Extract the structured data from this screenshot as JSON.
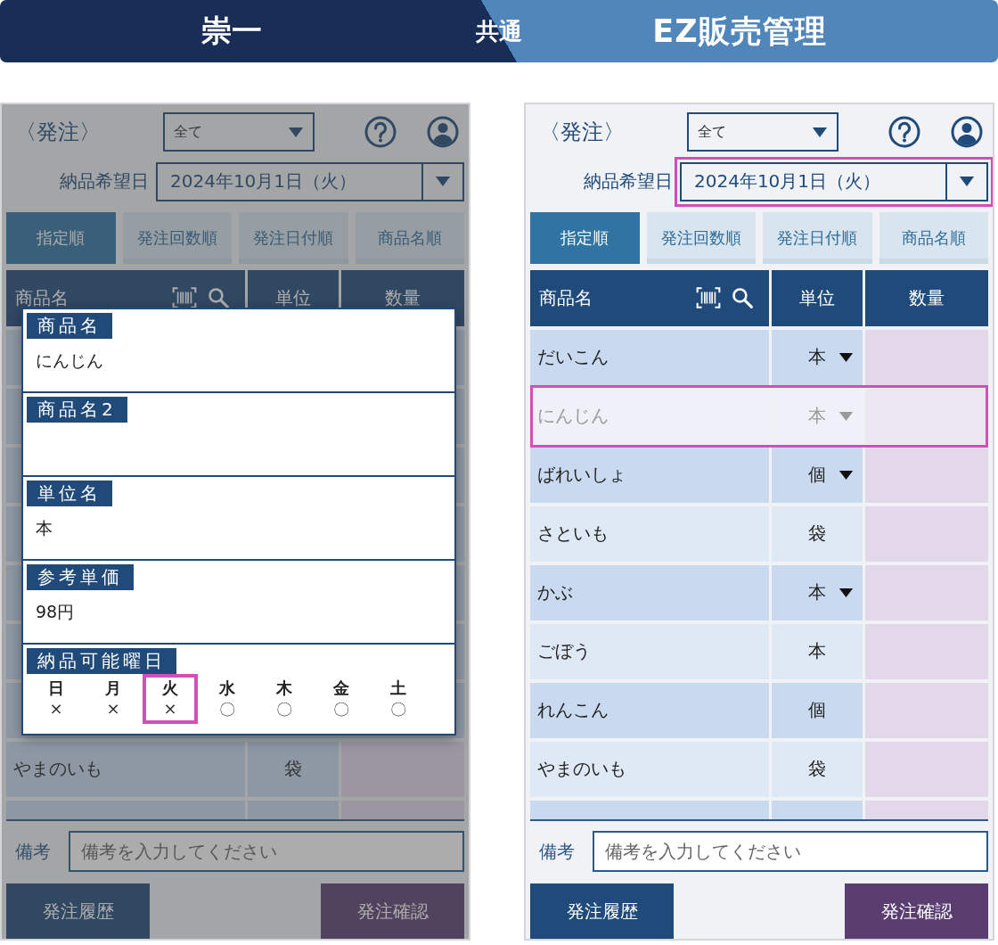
{
  "banner": {
    "left": "崇一",
    "center": "共通",
    "right": "EZ販売管理"
  },
  "screens": [
    {
      "title": "〈発注〉",
      "filter": "全て",
      "date_label": "納品希望日",
      "date": "2024年10月1日（火）",
      "date_highlighted": false,
      "dimmed": true,
      "sort_tabs": [
        {
          "label": "指定順",
          "selected": true
        },
        {
          "label": "発注回数順",
          "selected": false
        },
        {
          "label": "発注日付順",
          "selected": false
        },
        {
          "label": "商品名順",
          "selected": false
        }
      ],
      "columns": [
        "商品名",
        "単位",
        "数量"
      ],
      "rows": [
        {
          "name": "やまのいも",
          "unit": "袋",
          "kind": "fixed",
          "disabled": false,
          "highlighted": false
        }
      ],
      "note_label": "備考",
      "note_placeholder": "備考を入力してください",
      "buttons": [
        "発注履歴",
        "発注確認"
      ],
      "detail_popup": {
        "fields": [
          {
            "label": "商品名",
            "value": "にんじん"
          },
          {
            "label": "商品名2"
          },
          {
            "label": "単位名",
            "value": "本"
          },
          {
            "label": "参考単価",
            "value": "98円"
          }
        ],
        "weekday_label": "納品可能曜日",
        "weekdays": [
          {
            "day": "日",
            "mark": "×",
            "highlighted": false
          },
          {
            "day": "月",
            "mark": "×",
            "highlighted": false
          },
          {
            "day": "火",
            "mark": "×",
            "highlighted": true
          },
          {
            "day": "水",
            "mark": "〇",
            "highlighted": false
          },
          {
            "day": "木",
            "mark": "〇",
            "highlighted": false
          },
          {
            "day": "金",
            "mark": "〇",
            "highlighted": false
          },
          {
            "day": "土",
            "mark": "〇",
            "highlighted": false
          }
        ]
      }
    },
    {
      "title": "〈発注〉",
      "filter": "全て",
      "date_label": "納品希望日",
      "date": "2024年10月1日（火）",
      "date_highlighted": true,
      "dimmed": false,
      "sort_tabs": [
        {
          "label": "指定順",
          "selected": true
        },
        {
          "label": "発注回数順",
          "selected": false
        },
        {
          "label": "発注日付順",
          "selected": false
        },
        {
          "label": "商品名順",
          "selected": false
        }
      ],
      "columns": [
        "商品名",
        "単位",
        "数量"
      ],
      "rows": [
        {
          "name": "だいこん",
          "unit": "本",
          "kind": "select",
          "disabled": false,
          "highlighted": false
        },
        {
          "name": "にんじん",
          "unit": "本",
          "kind": "select",
          "disabled": true,
          "highlighted": true
        },
        {
          "name": "ばれいしょ",
          "unit": "個",
          "kind": "select",
          "disabled": false,
          "highlighted": false
        },
        {
          "name": "さといも",
          "unit": "袋",
          "kind": "fixed",
          "disabled": false,
          "highlighted": false
        },
        {
          "name": "かぶ",
          "unit": "本",
          "kind": "select",
          "disabled": false,
          "highlighted": false
        },
        {
          "name": "ごぼう",
          "unit": "本",
          "kind": "fixed",
          "disabled": false,
          "highlighted": false
        },
        {
          "name": "れんこん",
          "unit": "個",
          "kind": "fixed",
          "disabled": false,
          "highlighted": false
        },
        {
          "name": "やまのいも",
          "unit": "袋",
          "kind": "fixed",
          "disabled": false,
          "highlighted": false
        }
      ],
      "note_label": "備考",
      "note_placeholder": "備考を入力してください",
      "buttons": [
        "発注履歴",
        "発注確認"
      ]
    }
  ]
}
